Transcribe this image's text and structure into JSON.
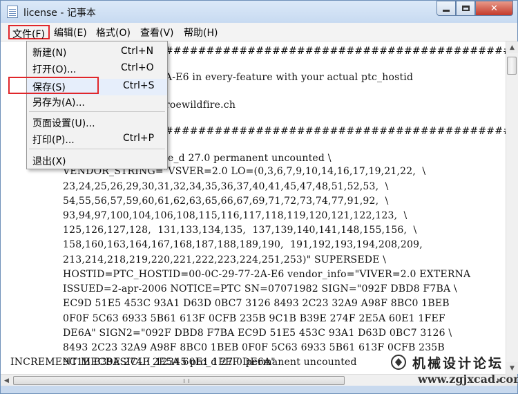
{
  "window": {
    "title": "license - 记事本"
  },
  "menubar": {
    "items": [
      "文件(F)",
      "编辑(E)",
      "格式(O)",
      "查看(V)",
      "帮助(H)"
    ]
  },
  "file_menu": {
    "items": [
      {
        "label": "新建(N)",
        "shortcut": "Ctrl+N"
      },
      {
        "label": "打开(O)...",
        "shortcut": "Ctrl+O"
      },
      {
        "label": "保存(S)",
        "shortcut": "Ctrl+S"
      },
      {
        "label": "另存为(A)...",
        "shortcut": ""
      },
      {
        "label": "页面设置(U)...",
        "shortcut": ""
      },
      {
        "label": "打印(P)...",
        "shortcut": "Ctrl+P"
      },
      {
        "label": "退出(X)",
        "shortcut": ""
      }
    ],
    "highlighted": "保存(S)"
  },
  "editor": {
    "lines": [
      "###########################################",
      "A-E6 in every-feature with your actual ptc_hostid",
      "roewildfire.ch",
      "###########################################",
      "e_d 27.0 permanent uncounted \\",
      "VENDOR_STRING=\"VSVER=2.0 LO=(0,3,6,7,9,10,14,16,17,19,21,22,  \\",
      "23,24,25,26,29,30,31,32,34,35,36,37,40,41,45,47,48,51,52,53,  \\",
      "54,55,56,57,59,60,61,62,63,65,66,67,69,71,72,73,74,77,91,92,  \\",
      "93,94,97,100,104,106,108,115,116,117,118,119,120,121,122,123,  \\",
      "125,126,127,128,  131,133,134,135,  137,139,140,141,148,155,156,  \\",
      "158,160,163,164,167,168,187,188,189,190,  191,192,193,194,208,209,",
      "213,214,218,219,220,221,222,223,224,251,253)\" SUPERSEDE \\",
      "HOSTID=PTC_HOSTID=00-0C-29-77-2A-E6 vendor_info=\"VIVER=2.0 EXTERNA",
      "ISSUED=2-apr-2006 NOTICE=PTC SN=07071982 SIGN=\"092F DBD8 F7BA \\",
      "EC9D 51E5 453C 93A1 D63D 0BC7 3126 8493 2C23 32A9 A98F 8BC0 1BEB",
      "0F0F 5C63 6933 5B61 613F 0CFB 235B 9C1B B39E 274F 2E5A 60E1 1FEF",
      "DE6A\" SIGN2=\"092F DBD8 F7BA EC9D 51E5 453C 93A1 D63D 0BC7 3126 \\",
      "8493 2C23 32A9 A98F 8BC0 1BEB 0F0F 5C63 6933 5B61 613F 0CFB 235B",
      "9C1B B39E 274F 2E5A 60E1 1FEF DE6A\"",
      "INCREMENT MECBASICUI_12345 ptc_d 27.0 permanent uncounted"
    ]
  },
  "watermark": {
    "name": "机械设计论坛",
    "url": "www.zgjxcad.com"
  }
}
